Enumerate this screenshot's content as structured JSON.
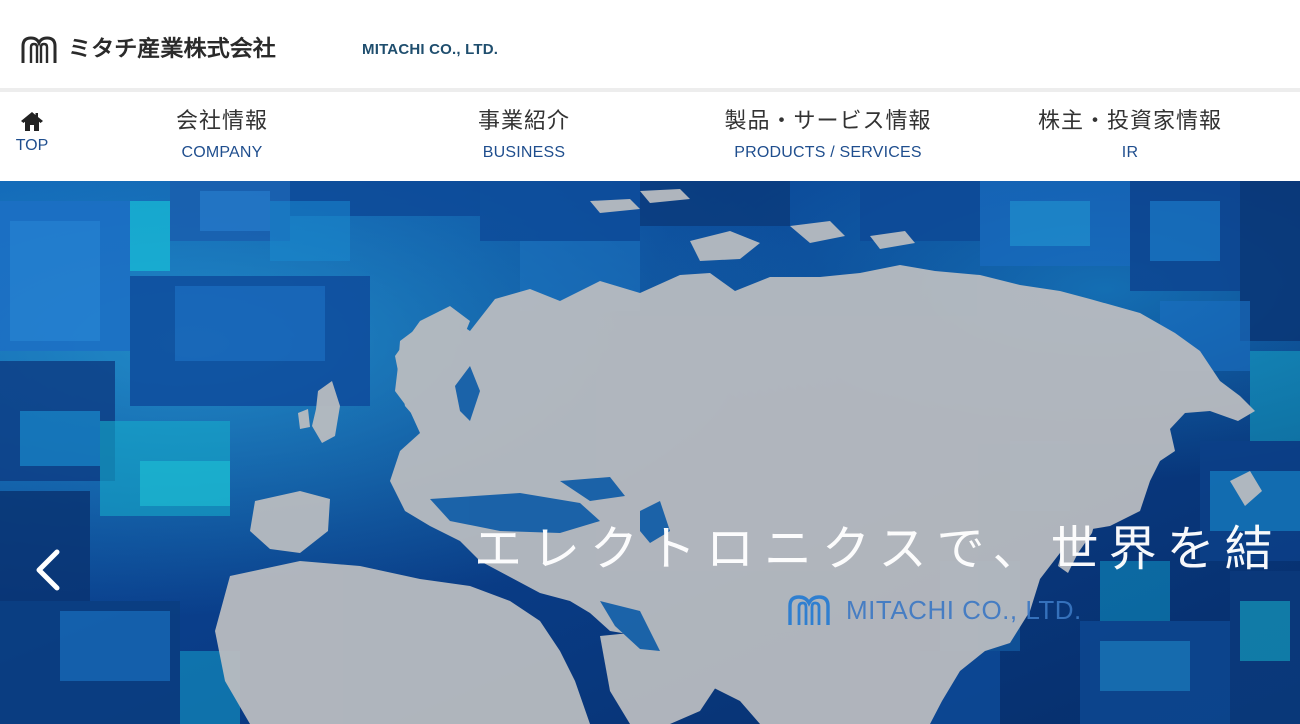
{
  "header": {
    "logo_jp": "ミタチ産業株式会社",
    "logo_en": "MITACHI CO., LTD."
  },
  "nav": {
    "home": {
      "icon": "home-icon",
      "label": "TOP"
    },
    "items": [
      {
        "jp": "会社情報",
        "en": "COMPANY"
      },
      {
        "jp": "事業紹介",
        "en": "BUSINESS"
      },
      {
        "jp": "製品・サービス情報",
        "en": "PRODUCTS / SERVICES"
      },
      {
        "jp": "株主・投資家情報",
        "en": "IR"
      }
    ]
  },
  "hero": {
    "tagline": "エレクトロニクスで、世界を結",
    "brand": "MITACHI CO., LTD.",
    "prev_icon": "chevron-left-icon"
  },
  "colors": {
    "brand_blue": "#1f4e8e",
    "logo_en": "#1f4e6e",
    "nav_text": "#333333",
    "hero_base": "#0b3a7a",
    "map_land": "#b9bcc0"
  }
}
